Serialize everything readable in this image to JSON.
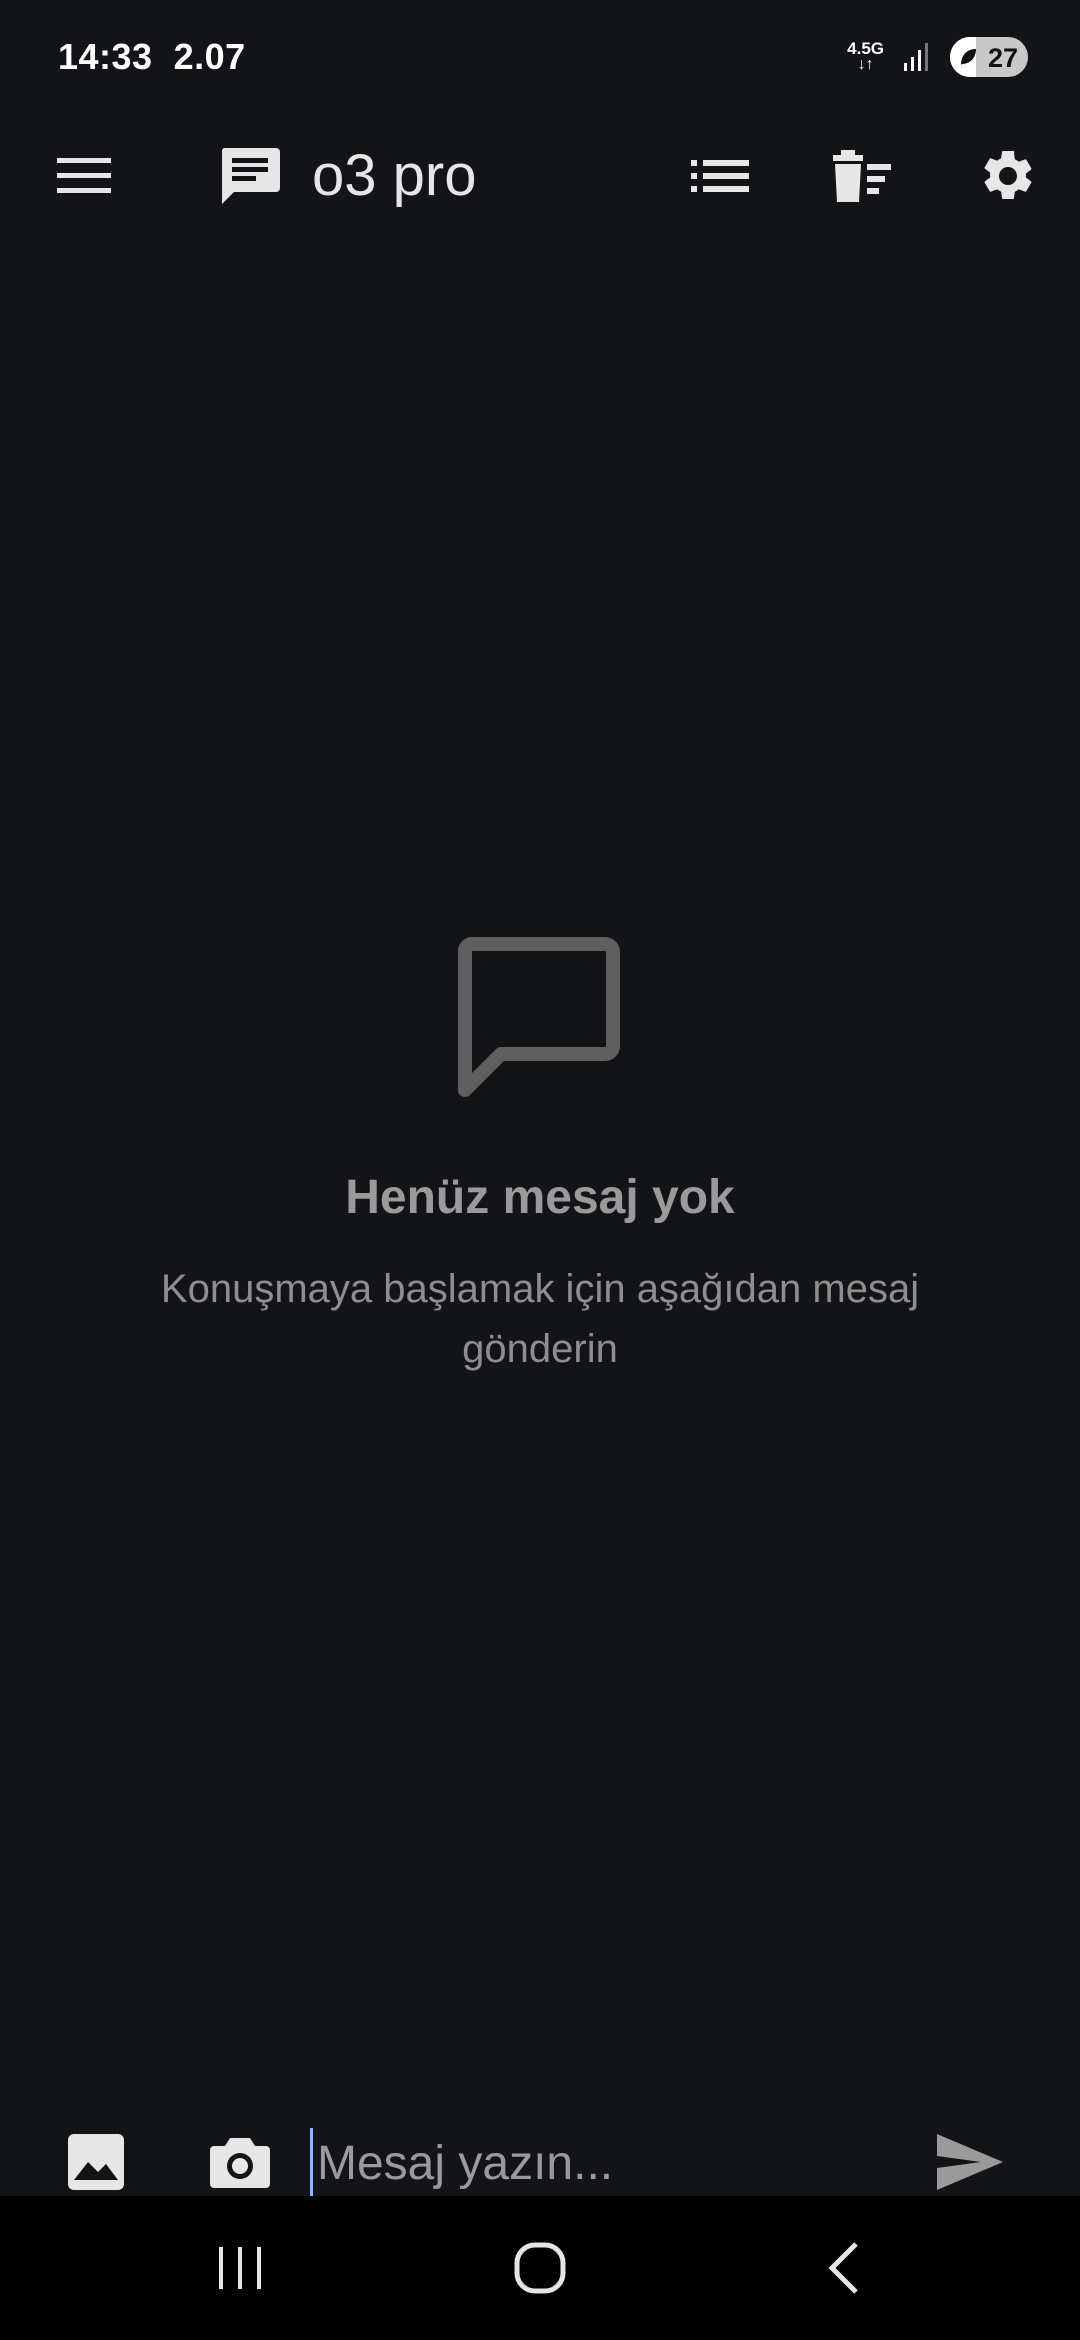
{
  "status": {
    "time": "14:33",
    "speed": "2.07",
    "network": "4.5G",
    "battery": "27"
  },
  "app_bar": {
    "title": "o3 pro",
    "icons": [
      "menu-icon",
      "chat-icon",
      "list-icon",
      "clear-all-icon",
      "settings-icon"
    ]
  },
  "empty_state": {
    "title": "Henüz mesaj yok",
    "subtitle": "Konuşmaya başlamak için aşağıdan mesaj gönderin"
  },
  "composer": {
    "placeholder": "Mesaj yazın...",
    "value": ""
  },
  "colors": {
    "background": "#121418",
    "text": "#e6e6e6",
    "muted": "#8e8e8e",
    "cursor": "#8fb3ff"
  }
}
